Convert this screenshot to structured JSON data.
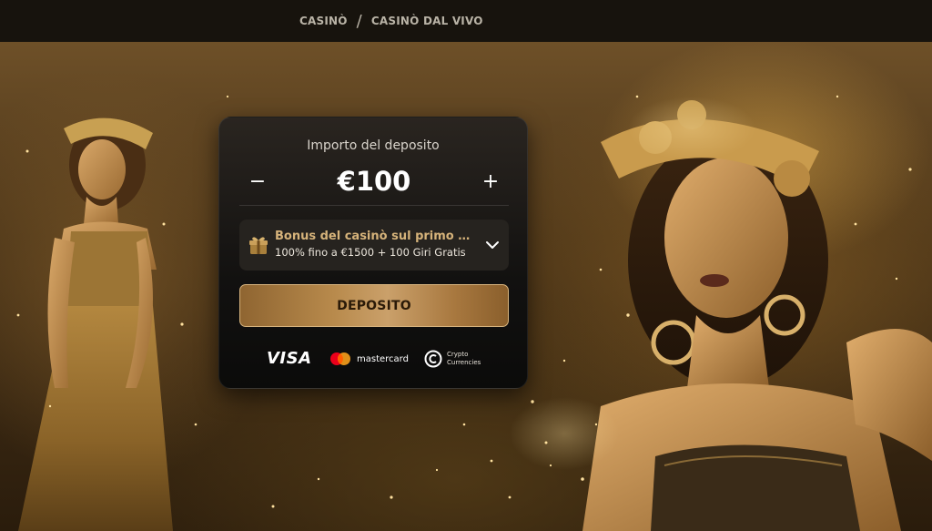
{
  "breadcrumb": {
    "items": [
      "CASINÒ",
      "CASINÒ DAL VIVO"
    ],
    "separator": "/"
  },
  "deposit_panel": {
    "title": "Importo del deposito",
    "amount": "€100",
    "decrement_symbol": "−",
    "increment_symbol": "+",
    "bonus": {
      "title": "Bonus del casinò sul primo dep...",
      "subtitle": "100% fino a €1500 + 100 Giri Gratis",
      "icon": "gift-icon"
    },
    "deposit_button_label": "DEPOSITO",
    "payment_methods": {
      "visa": "VISA",
      "mastercard": "mastercard",
      "crypto_line1": "Crypto",
      "crypto_line2": "Currencies"
    }
  },
  "colors": {
    "accent_gold": "#d6b37a",
    "button_gold": "#b88a4c",
    "panel_bg": "#121110",
    "topbar_bg": "#17130d"
  }
}
